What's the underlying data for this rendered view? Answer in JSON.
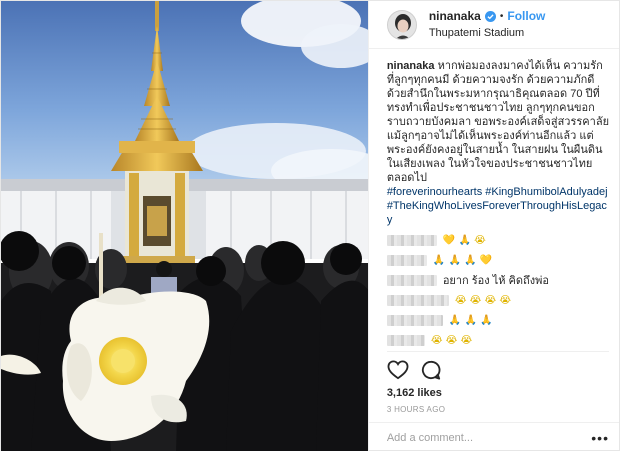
{
  "post": {
    "username": "ninanaka",
    "follow_label": "Follow",
    "location": "Thupatemi Stadium",
    "separator": "•",
    "caption_user": "ninanaka",
    "caption_text": "หากพ่อมองลงมาคงได้เห็น ความรักที่ลูกๆทุกคนมี ด้วยความจงรัก ด้วยความภักดี ด้วยสำนึกในพระมหากรุณาธิคุณตลอด 70 ปีที่ทรงทำเพื่อประชาชนชาวไทย ลูกๆทุกคนขอกราบถวายบังคมลา ขอพระองค์เสด็จสู่สวรรคาลัย แม้ลูกๆอาจไม่ได้เห็นพระองค์ท่านอีกแล้ว แต่พระองค์ยังคงอยู่ในสายน้ำ ในสายฝน ในผืนดิน ในเสียงเพลง ในหัวใจของประชาชนชาวไทยตลอดไป",
    "hashtags": "#foreverinourhearts #KingBhumibolAdulyadej #TheKingWhoLivesForeverThroughHisLegacy",
    "comments": [
      {
        "text": "",
        "emoji": "💛 🙏 😭"
      },
      {
        "text": "",
        "emoji": "🙏 🙏 🙏 💛"
      },
      {
        "text": "อยาก ร้อง ไห้ คิดถึงพ่อ",
        "emoji": ""
      },
      {
        "text": "",
        "emoji": "😭 😭 😭 😭"
      },
      {
        "text": "",
        "emoji": "🙏 🙏 🙏"
      },
      {
        "text": "",
        "emoji": "😭 😭 😭"
      }
    ],
    "likes": "3,162 likes",
    "time_ago": "3 HOURS AGO",
    "add_comment_placeholder": "Add a comment...",
    "more_label": "•••"
  },
  "icons": {
    "verified": "verified-badge-icon",
    "like": "heart-icon",
    "comment": "comment-bubble-icon",
    "more": "more-options-icon"
  },
  "colors": {
    "link_blue": "#3897f0",
    "hashtag": "#003569",
    "sky_top": "#4a73b8",
    "sky_bottom": "#9ec3e9",
    "gold": "#d9a93c",
    "muted": "#999999"
  }
}
